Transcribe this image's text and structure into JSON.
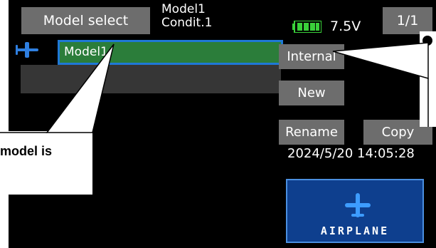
{
  "header": {
    "title_button": "Model select",
    "model_name_line1": "Model1",
    "model_name_line2": "Condit.1",
    "battery_voltage": "7.5V",
    "page_indicator": "1/1"
  },
  "model_list": {
    "selected_item": "Model1",
    "icon": "airplane-icon"
  },
  "buttons": {
    "internal": "Internal",
    "new": "New",
    "rename": "Rename",
    "copy": "Copy"
  },
  "datetime": "2024/5/20 14:05:28",
  "model_type": {
    "label": "AIRPLANE",
    "icon": "airplane-icon"
  },
  "callout": {
    "text": "model is"
  },
  "colors": {
    "screen_bg": "#000000",
    "button_bg": "#6d6d6d",
    "selected_row_bg": "#2b7d3a",
    "selected_row_border": "#1f78d6",
    "type_tile_bg": "#0e3f8e",
    "icon_blue": "#2f7fe0",
    "battery_green": "#3ad13a"
  }
}
